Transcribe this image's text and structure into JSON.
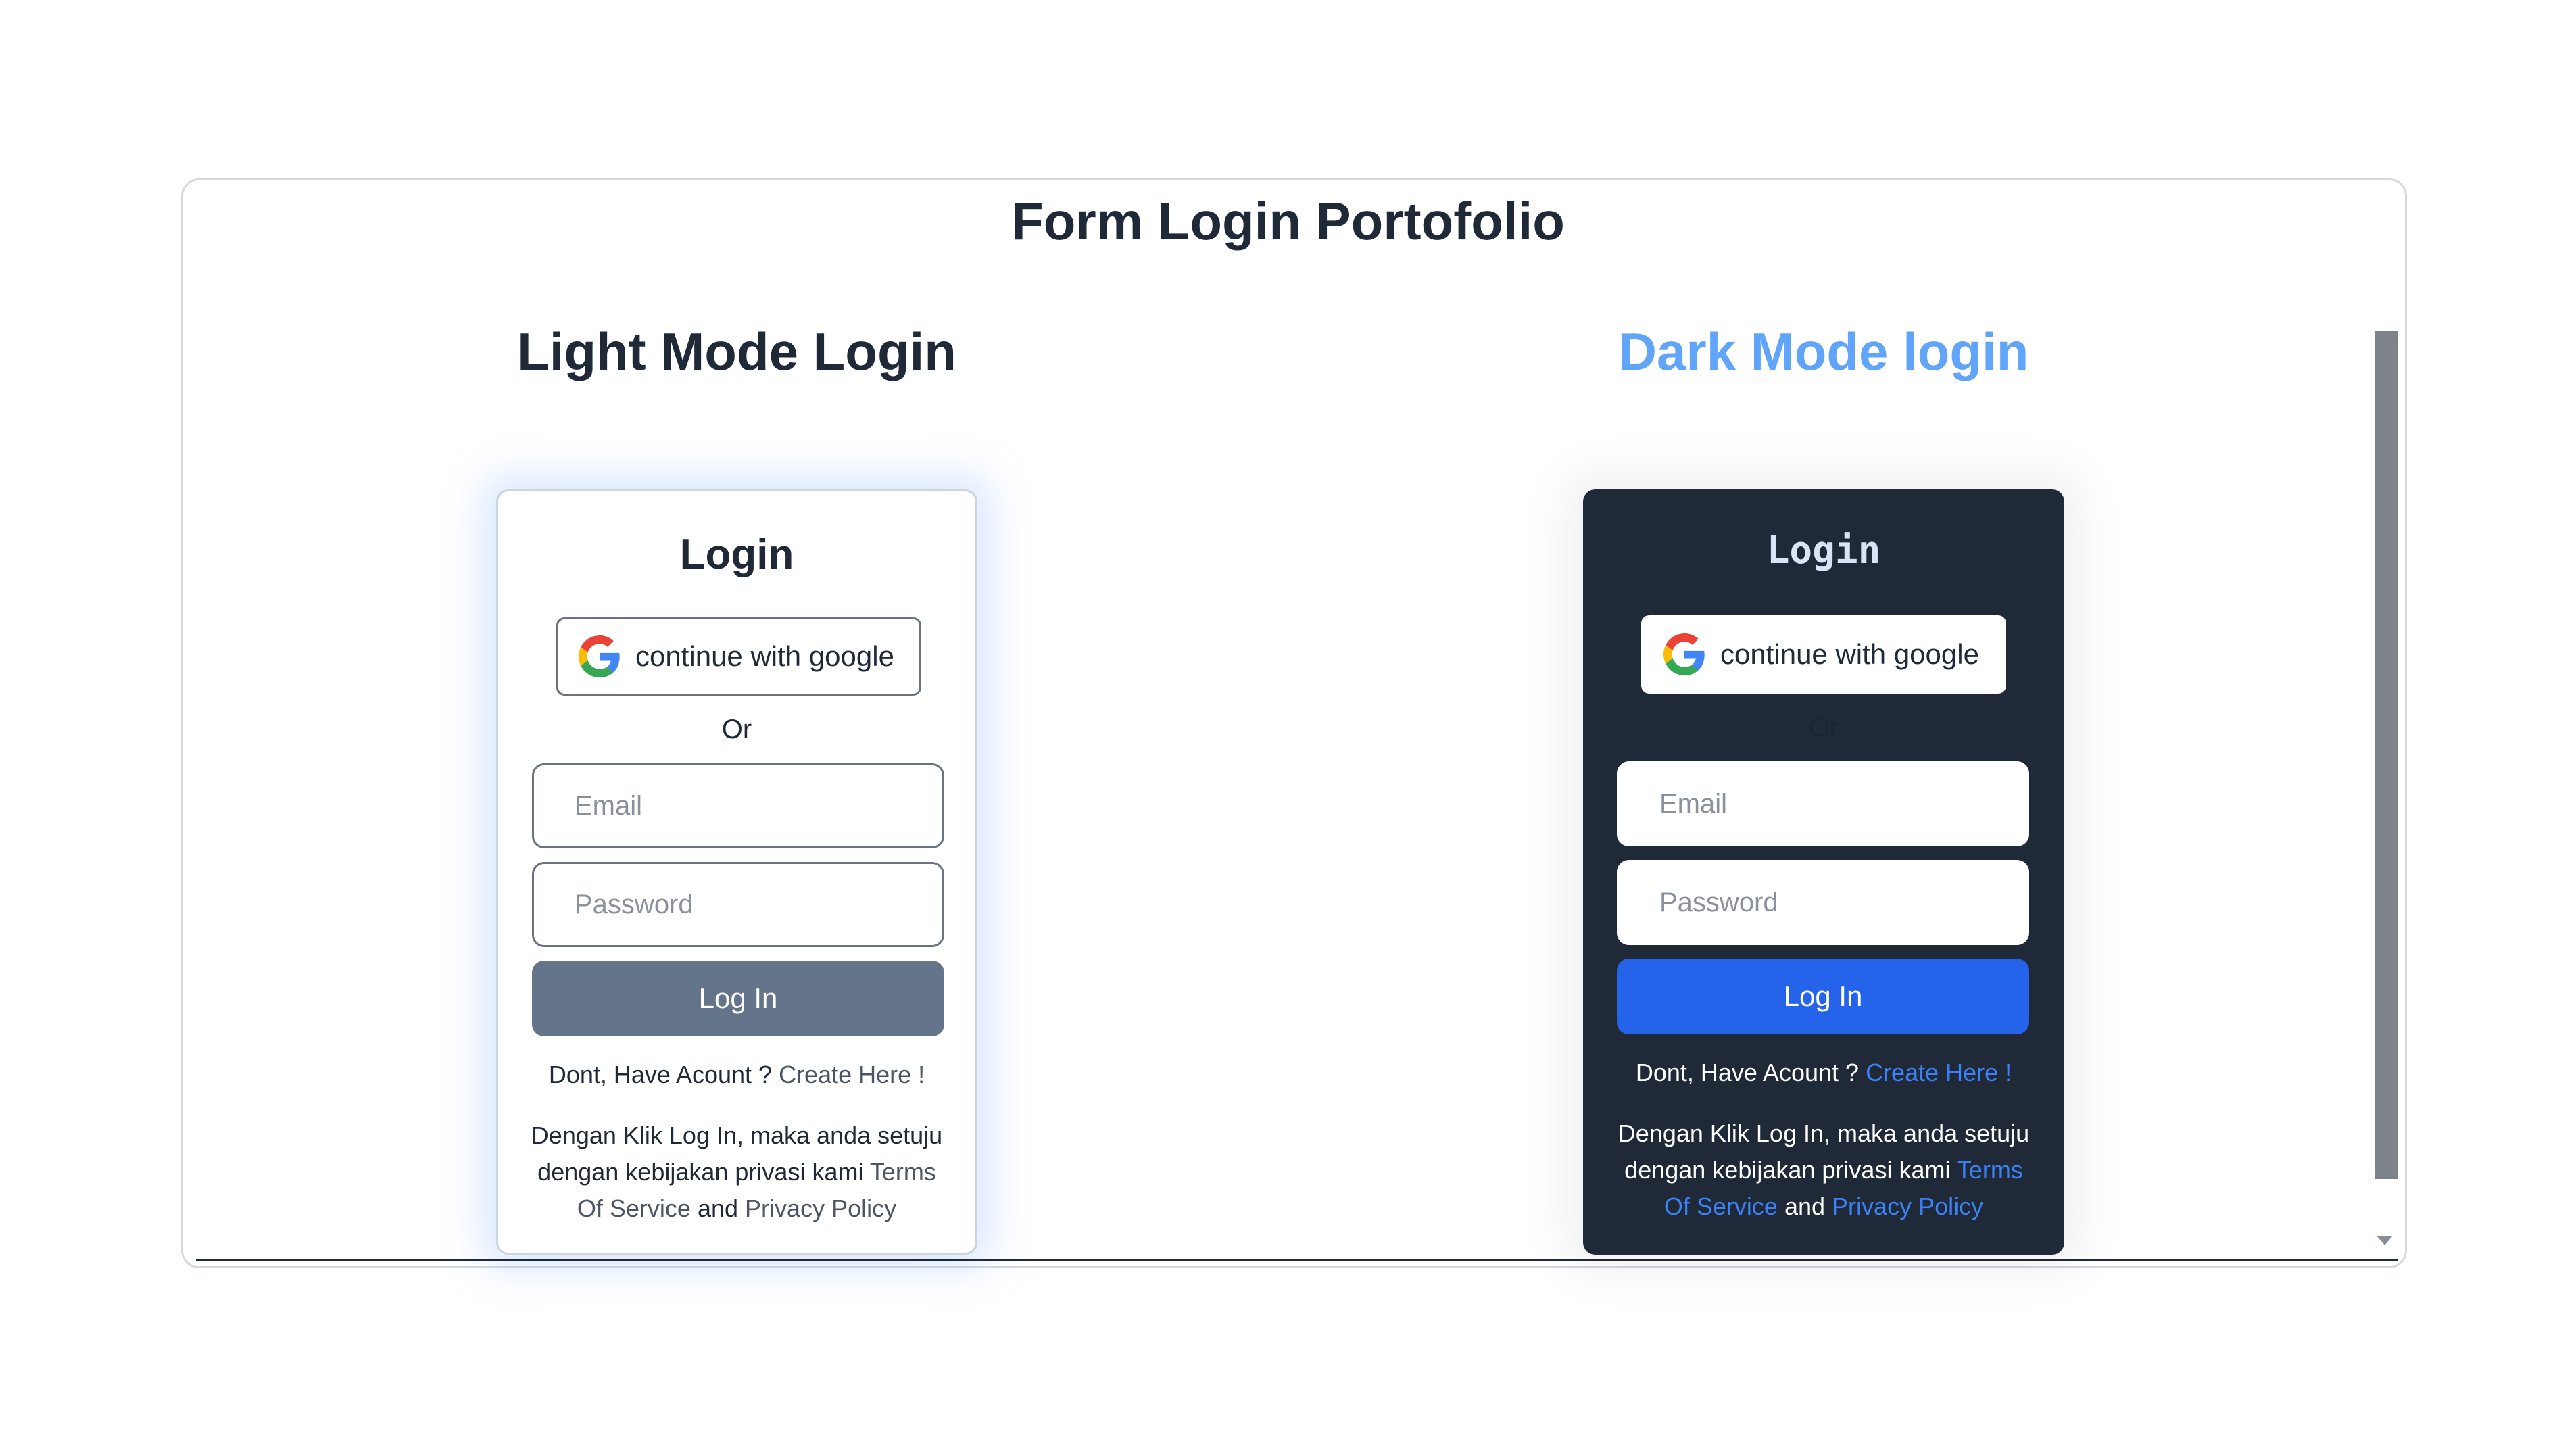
{
  "page": {
    "title": "Form Login Portofolio"
  },
  "light_section": {
    "heading": "Light Mode Login",
    "card": {
      "title": "Login",
      "google_button": "continue with google",
      "or_text": "Or",
      "email_placeholder": "Email",
      "password_placeholder": "Password",
      "login_button": "Log In",
      "signup_prefix": "Dont, Have Acount ?",
      "signup_link": "Create Here !",
      "terms_prefix": "Dengan Klik Log In, maka anda setuju dengan kebijakan privasi kami",
      "terms_link": "Terms Of Service",
      "terms_and": "and",
      "privacy_link": "Privacy Policy"
    }
  },
  "dark_section": {
    "heading": "Dark Mode login",
    "card": {
      "title": "Login",
      "google_button": "continue with google",
      "or_text": "Or",
      "email_placeholder": "Email",
      "password_placeholder": "Password",
      "login_button": "Log In",
      "signup_prefix": "Dont, Have Acount ?",
      "signup_link": "Create Here !",
      "terms_prefix": "Dengan Klik Log In, maka anda setuju dengan kebijakan privasi kami",
      "terms_link": "Terms Of Service",
      "terms_and": "and",
      "privacy_link": "Privacy Policy"
    }
  },
  "icons": {
    "google": "google-g-logo",
    "scroll_down": "chevron-down"
  },
  "colors": {
    "text_dark": "#1f2937",
    "dark_heading": "#60a5fa",
    "light_login_button": "#64748b",
    "dark_card_bg": "#1f2937",
    "dark_login_button": "#2563eb",
    "dark_link": "#3b82f6",
    "light_link": "#4b5563"
  }
}
